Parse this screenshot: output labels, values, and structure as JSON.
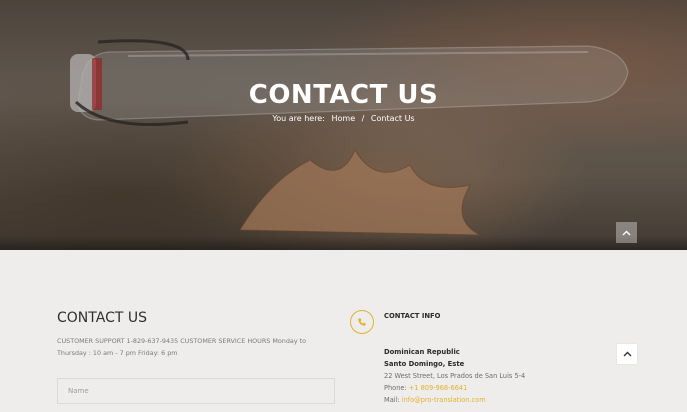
{
  "hero": {
    "title": "CONTACT US",
    "breadcrumb_prefix": "You are here:",
    "breadcrumb_home": "Home",
    "breadcrumb_sep": "/",
    "breadcrumb_current": "Contact Us"
  },
  "contact_form": {
    "title": "CONTACT US",
    "description": "CUSTOMER SUPPORT 1-829-637-9435 CUSTOMER SERVICE HOURS Monday to Thursday : 10 am - 7 pm Friday: 6 pm",
    "name_placeholder": "Name"
  },
  "contact_info": {
    "title": "CONTACT INFO",
    "country": "Dominican Republic",
    "city": "Santo Domingo, Este",
    "street": "22 West Street, Los Prados de San Luis 5-4",
    "phone_label": "Phone:",
    "phone": "+1 809-968-6641",
    "mail_label": "Mail:",
    "mail": "info@pro-translation.com"
  },
  "icons": {
    "phone": "phone-icon",
    "scroll_up": "chevron-up-icon"
  },
  "colors": {
    "accent": "#e2b12f",
    "background": "#efedeb",
    "hero_text": "#ffffff"
  }
}
